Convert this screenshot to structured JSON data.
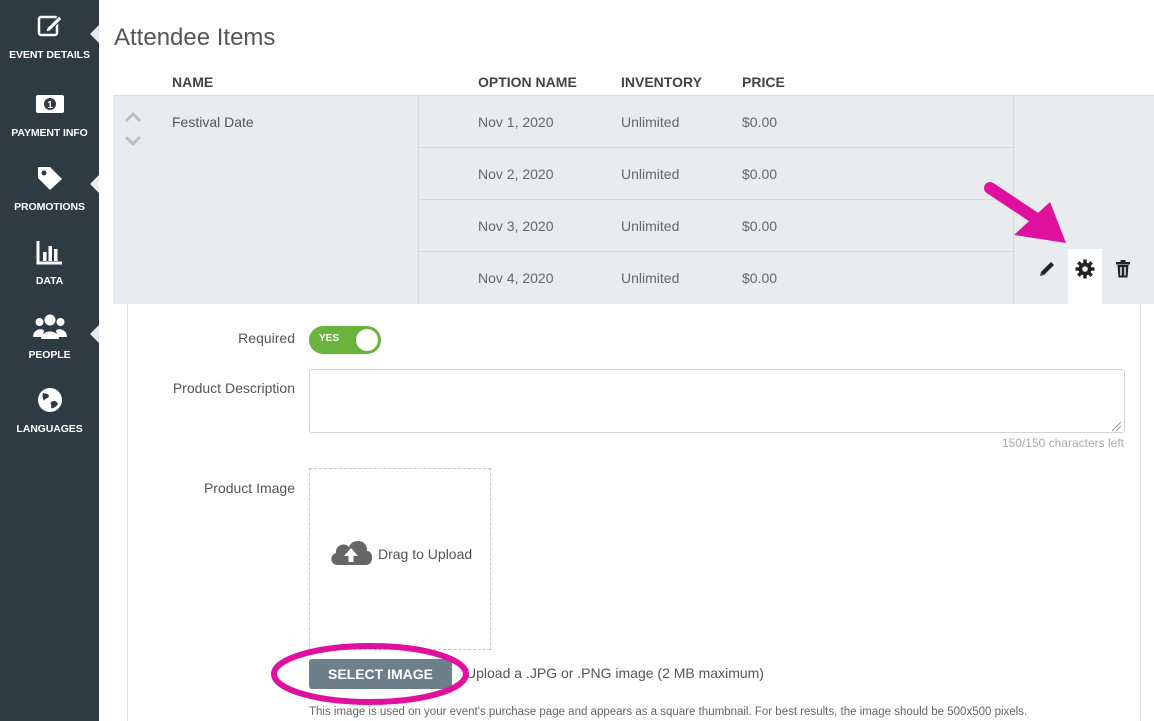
{
  "sidebar": {
    "items": [
      {
        "label": "EVENT DETAILS",
        "icon": "edit-icon"
      },
      {
        "label": "PAYMENT INFO",
        "icon": "money-icon"
      },
      {
        "label": "PROMOTIONS",
        "icon": "tag-icon"
      },
      {
        "label": "DATA",
        "icon": "bar-chart-icon"
      },
      {
        "label": "PEOPLE",
        "icon": "people-icon"
      },
      {
        "label": "LANGUAGES",
        "icon": "globe-icon"
      }
    ]
  },
  "main": {
    "title": "Attendee Items",
    "columns": {
      "name": "NAME",
      "option_name": "OPTION NAME",
      "inventory": "INVENTORY",
      "price": "PRICE"
    },
    "item": {
      "name": "Festival Date",
      "options": [
        {
          "option_name": "Nov 1, 2020",
          "inventory": "Unlimited",
          "price": "$0.00"
        },
        {
          "option_name": "Nov 2, 2020",
          "inventory": "Unlimited",
          "price": "$0.00"
        },
        {
          "option_name": "Nov 3, 2020",
          "inventory": "Unlimited",
          "price": "$0.00"
        },
        {
          "option_name": "Nov 4, 2020",
          "inventory": "Unlimited",
          "price": "$0.00"
        }
      ],
      "actions": [
        "pencil-icon",
        "gear-icon",
        "trash-icon"
      ]
    }
  },
  "settings": {
    "required_label": "Required",
    "required_toggle": "YES",
    "description_label": "Product Description",
    "description_value": "",
    "chars_left": "150/150 characters left",
    "image_label": "Product Image",
    "drop_text": "Drag to Upload",
    "select_button": "SELECT IMAGE",
    "upload_note": "Upload a .JPG or .PNG image (2 MB maximum)",
    "upload_help": "This image is used on your event's purchase page and appears as a square thumbnail. For best results, the image should be 500x500 pixels."
  },
  "colors": {
    "sidebar_bg": "#2f3b42",
    "toggle_on": "#6ab43e",
    "button": "#6c7f8b",
    "annotation": "#e0109f"
  }
}
